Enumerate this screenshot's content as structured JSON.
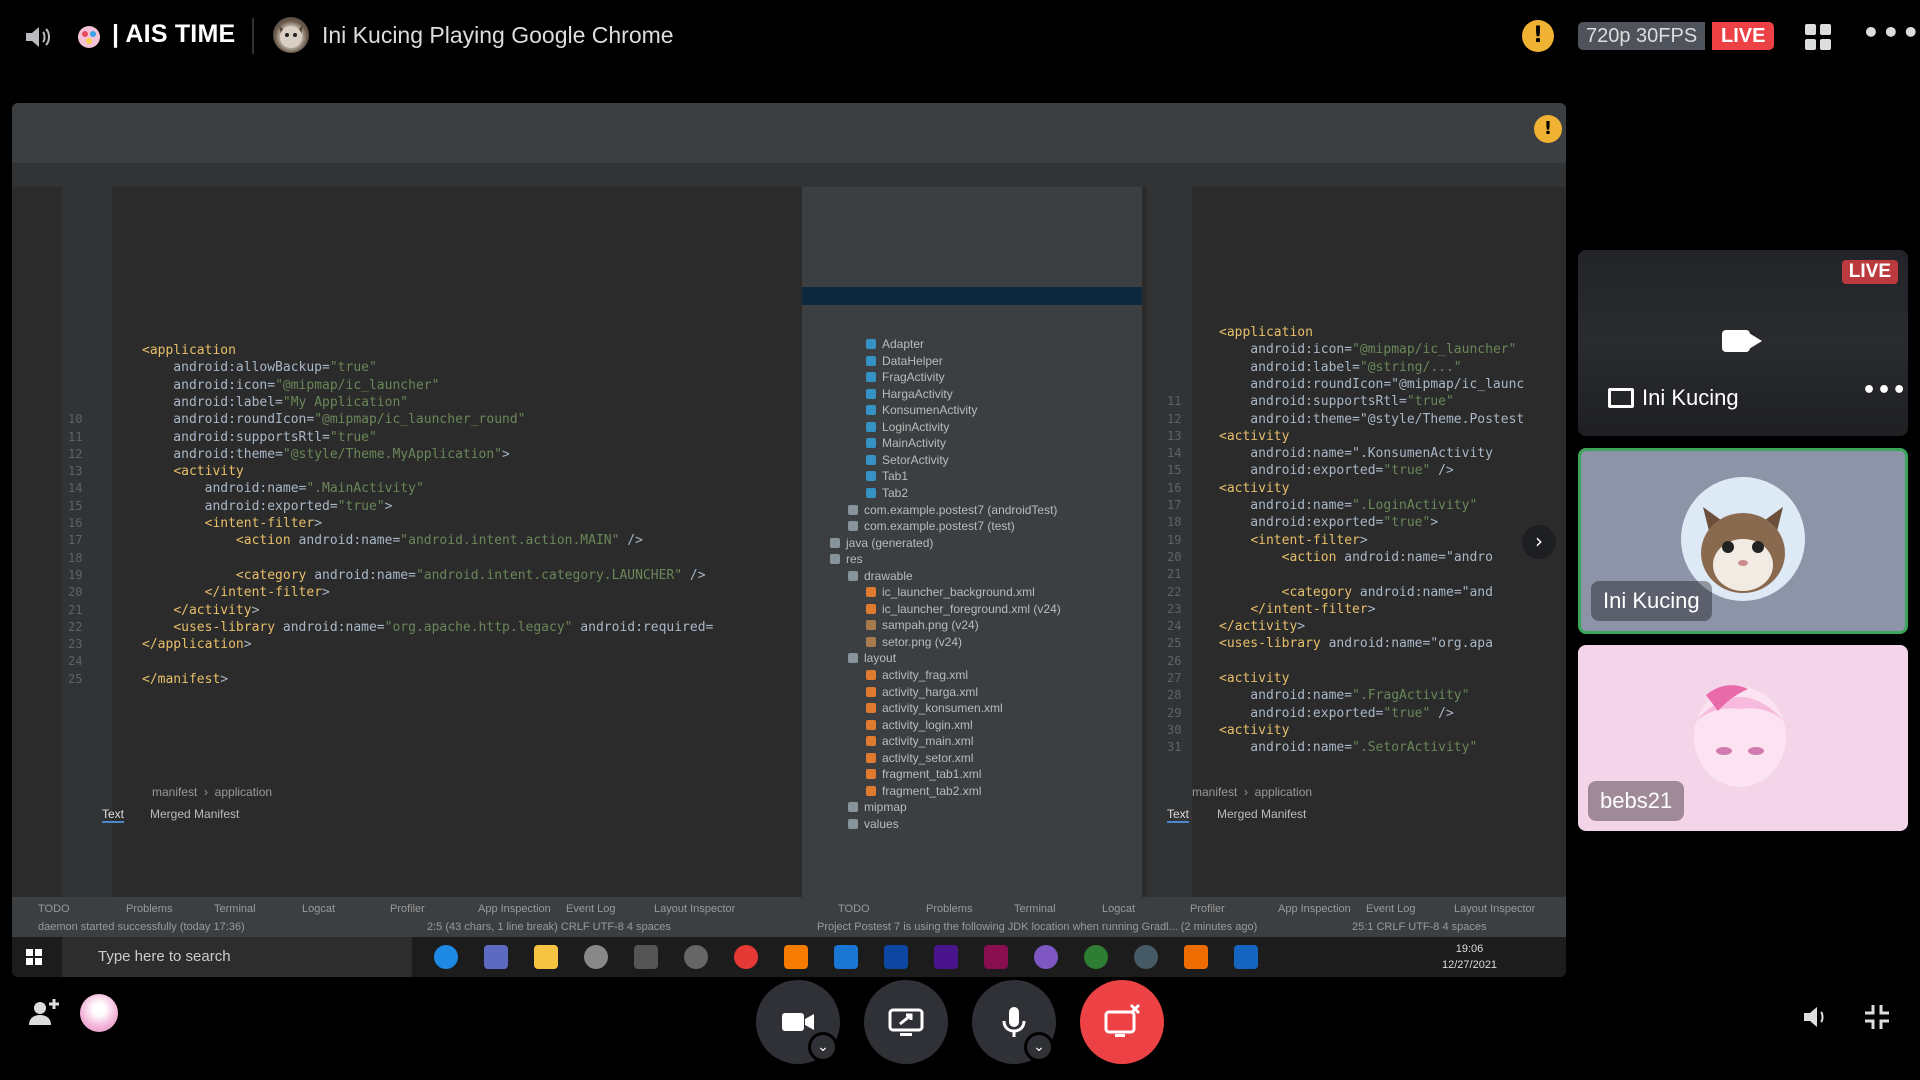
{
  "topbar": {
    "server_name": "| AIS TIME",
    "channel_title": "Ini Kucing Playing Google Chrome",
    "quality": "720p 30FPS",
    "live": "LIVE",
    "icons": [
      "speaker-icon",
      "server-emoji-icon",
      "warning-icon",
      "grid-layout-icon",
      "more-icon"
    ]
  },
  "stream": {
    "left_code": [
      {
        "n": "",
        "t": "<application"
      },
      {
        "n": "",
        "t": "    android:allowBackup=\"true\""
      },
      {
        "n": "",
        "t": "    android:icon=\"@mipmap/ic_launcher\""
      },
      {
        "n": "",
        "t": "    android:label=\"My Application\""
      },
      {
        "n": "10",
        "t": "    android:roundIcon=\"@mipmap/ic_launcher_round\""
      },
      {
        "n": "11",
        "t": "    android:supportsRtl=\"true\""
      },
      {
        "n": "12",
        "t": "    android:theme=\"@style/Theme.MyApplication\">"
      },
      {
        "n": "13",
        "t": "    <activity"
      },
      {
        "n": "14",
        "t": "        android:name=\".MainActivity\""
      },
      {
        "n": "15",
        "t": "        android:exported=\"true\">"
      },
      {
        "n": "16",
        "t": "        <intent-filter>"
      },
      {
        "n": "17",
        "t": "            <action android:name=\"android.intent.action.MAIN\" />"
      },
      {
        "n": "18",
        "t": ""
      },
      {
        "n": "19",
        "t": "            <category android:name=\"android.intent.category.LAUNCHER\" />"
      },
      {
        "n": "20",
        "t": "        </intent-filter>"
      },
      {
        "n": "21",
        "t": "    </activity>"
      },
      {
        "n": "22",
        "t": "    <uses-library android:name=\"org.apache.http.legacy\" android:required="
      },
      {
        "n": "23",
        "t": "</application>"
      },
      {
        "n": "24",
        "t": ""
      },
      {
        "n": "25",
        "t": "</manifest>"
      }
    ],
    "tree": [
      {
        "label": "Adapter",
        "indent": 3,
        "kind": "class"
      },
      {
        "label": "DataHelper",
        "indent": 3,
        "kind": "class"
      },
      {
        "label": "FragActivity",
        "indent": 3,
        "kind": "class"
      },
      {
        "label": "HargaActivity",
        "indent": 3,
        "kind": "class"
      },
      {
        "label": "KonsumenActivity",
        "indent": 3,
        "kind": "class"
      },
      {
        "label": "LoginActivity",
        "indent": 3,
        "kind": "class"
      },
      {
        "label": "MainActivity",
        "indent": 3,
        "kind": "class"
      },
      {
        "label": "SetorActivity",
        "indent": 3,
        "kind": "class"
      },
      {
        "label": "Tab1",
        "indent": 3,
        "kind": "class"
      },
      {
        "label": "Tab2",
        "indent": 3,
        "kind": "class"
      },
      {
        "label": "com.example.postest7 (androidTest)",
        "indent": 2,
        "kind": "folder"
      },
      {
        "label": "com.example.postest7 (test)",
        "indent": 2,
        "kind": "folder"
      },
      {
        "label": "java (generated)",
        "indent": 1,
        "kind": "folder"
      },
      {
        "label": "res",
        "indent": 1,
        "kind": "folder"
      },
      {
        "label": "drawable",
        "indent": 2,
        "kind": "folder"
      },
      {
        "label": "ic_launcher_background.xml",
        "indent": 3,
        "kind": "xml"
      },
      {
        "label": "ic_launcher_foreground.xml (v24)",
        "indent": 3,
        "kind": "xml"
      },
      {
        "label": "sampah.png (v24)",
        "indent": 3,
        "kind": "img"
      },
      {
        "label": "setor.png (v24)",
        "indent": 3,
        "kind": "img"
      },
      {
        "label": "layout",
        "indent": 2,
        "kind": "folder"
      },
      {
        "label": "activity_frag.xml",
        "indent": 3,
        "kind": "xml"
      },
      {
        "label": "activity_harga.xml",
        "indent": 3,
        "kind": "xml"
      },
      {
        "label": "activity_konsumen.xml",
        "indent": 3,
        "kind": "xml"
      },
      {
        "label": "activity_login.xml",
        "indent": 3,
        "kind": "xml"
      },
      {
        "label": "activity_main.xml",
        "indent": 3,
        "kind": "xml"
      },
      {
        "label": "activity_setor.xml",
        "indent": 3,
        "kind": "xml"
      },
      {
        "label": "fragment_tab1.xml",
        "indent": 3,
        "kind": "xml"
      },
      {
        "label": "fragment_tab2.xml",
        "indent": 3,
        "kind": "xml"
      },
      {
        "label": "mipmap",
        "indent": 2,
        "kind": "folder"
      },
      {
        "label": "values",
        "indent": 2,
        "kind": "folder"
      }
    ],
    "right_code": [
      {
        "n": "",
        "t": "<application"
      },
      {
        "n": "",
        "t": "    android:icon=\"@mipmap/ic_launcher\""
      },
      {
        "n": "",
        "t": "    android:label=\"@string/...\""
      },
      {
        "n": "",
        "t": "    android:roundIcon=\"@mipmap/ic_launc"
      },
      {
        "n": "11",
        "t": "    android:supportsRtl=\"true\""
      },
      {
        "n": "12",
        "t": "    android:theme=\"@style/Theme.Postest"
      },
      {
        "n": "13",
        "t": "<activity"
      },
      {
        "n": "14",
        "t": "    android:name=\".KonsumenActivity"
      },
      {
        "n": "15",
        "t": "    android:exported=\"true\" />"
      },
      {
        "n": "16",
        "t": "<activity"
      },
      {
        "n": "17",
        "t": "    android:name=\".LoginActivity\""
      },
      {
        "n": "18",
        "t": "    android:exported=\"true\">"
      },
      {
        "n": "19",
        "t": "    <intent-filter>"
      },
      {
        "n": "20",
        "t": "        <action android:name=\"andro"
      },
      {
        "n": "21",
        "t": ""
      },
      {
        "n": "22",
        "t": "        <category android:name=\"and"
      },
      {
        "n": "23",
        "t": "    </intent-filter>"
      },
      {
        "n": "24",
        "t": "</activity>"
      },
      {
        "n": "25",
        "t": "<uses-library android:name=\"org.apa"
      },
      {
        "n": "26",
        "t": ""
      },
      {
        "n": "27",
        "t": "<activity"
      },
      {
        "n": "28",
        "t": "    android:name=\".FragActivity\""
      },
      {
        "n": "29",
        "t": "    android:exported=\"true\" />"
      },
      {
        "n": "30",
        "t": "<activity"
      },
      {
        "n": "31",
        "t": "    android:name=\".SetorActivity\""
      }
    ],
    "breadcrumb_left": "manifest  ›  application",
    "breadcrumb_right": "manifest  ›  application",
    "tab_text": "Text",
    "tab_merged": "Merged Manifest",
    "tools": [
      "TODO",
      "Problems",
      "Terminal",
      "Logcat",
      "Profiler",
      "App Inspection",
      "Event Log",
      "Layout Inspector"
    ],
    "status_left": "daemon started successfully (today 17:36)",
    "status_left_pos": "2:5 (43 chars, 1 line break)  CRLF  UTF-8  4 spaces",
    "status_right": "Project Postest 7 is using the following JDK location when running Gradl... (2 minutes ago)",
    "status_right_pos": "25:1  CRLF  UTF-8  4 spaces",
    "search_placeholder": "Type here to search",
    "time": "19:06",
    "date": "12/27/2021"
  },
  "tiles": {
    "stream_tile": {
      "live": "LIVE",
      "name": "Ini Kucing"
    },
    "cat_tile": {
      "name": "Ini Kucing"
    },
    "bebs_tile": {
      "name": "bebs21"
    }
  },
  "colors": {
    "accent_live": "#ed4245",
    "speaking_border": "#3ba55c",
    "warning": "#f0b232"
  }
}
